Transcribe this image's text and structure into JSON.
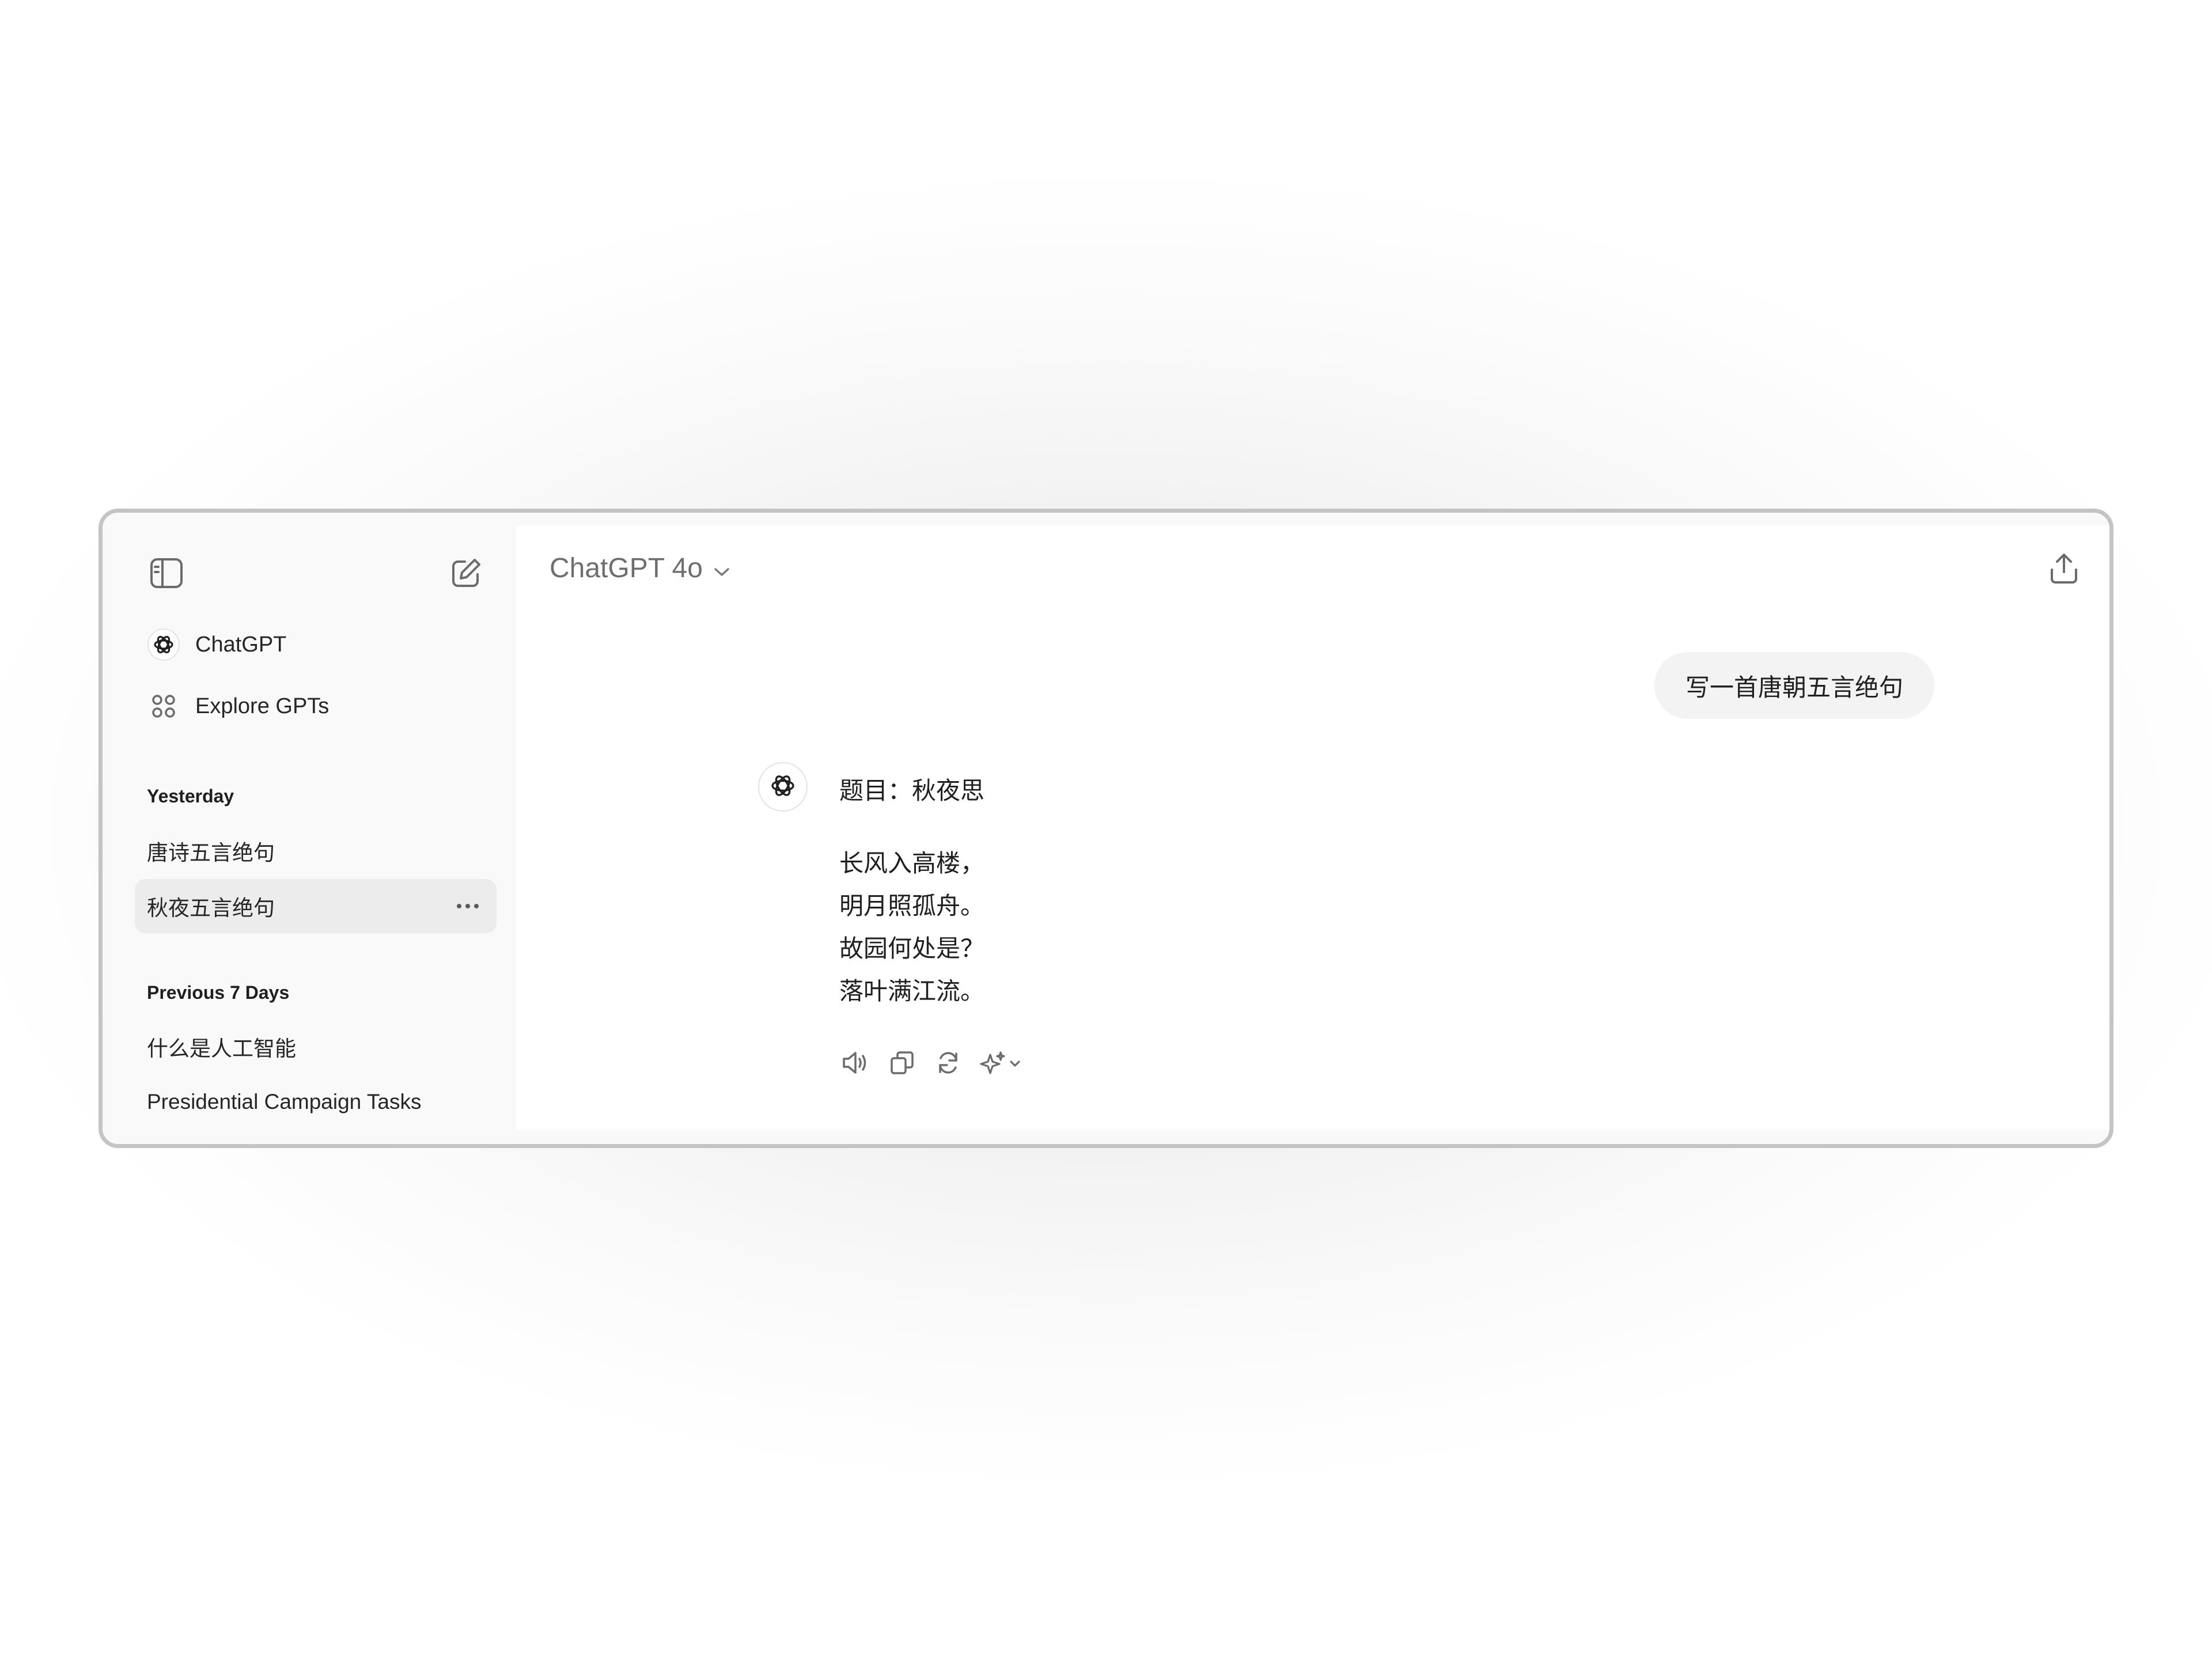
{
  "sidebar": {
    "toggle_icon": "sidebar-toggle-icon",
    "new_chat_icon": "compose-icon",
    "nav": [
      {
        "icon": "openai-logo-icon",
        "label": "ChatGPT"
      },
      {
        "icon": "grid-icon",
        "label": "Explore GPTs"
      }
    ],
    "sections": [
      {
        "title": "Yesterday",
        "items": [
          {
            "label": "唐诗五言绝句"
          },
          {
            "label": "秋夜五言绝句",
            "active": true
          }
        ]
      },
      {
        "title": "Previous 7 Days",
        "items": [
          {
            "label": "什么是人工智能"
          },
          {
            "label": "Presidential Campaign Tasks"
          }
        ]
      }
    ]
  },
  "header": {
    "model": "ChatGPT 4o",
    "share_icon": "share-upload-icon"
  },
  "conversation": {
    "user_message": "写一首唐朝五言绝句",
    "assistant": {
      "title": "题目：秋夜思",
      "lines": [
        "长风入高楼，",
        "明月照孤舟。",
        "故园何处是？",
        "落叶满江流。"
      ]
    },
    "actions": [
      "speaker-icon",
      "copy-icon",
      "regenerate-icon",
      "sparkle-icon"
    ]
  },
  "colors": {
    "window_border": "#c4c4c4",
    "sidebar_bg": "#f9f9f9",
    "active_item_bg": "#ececec",
    "bubble_bg": "#f3f3f3",
    "text": "#1f1f1f",
    "muted": "#6e6e6e"
  }
}
